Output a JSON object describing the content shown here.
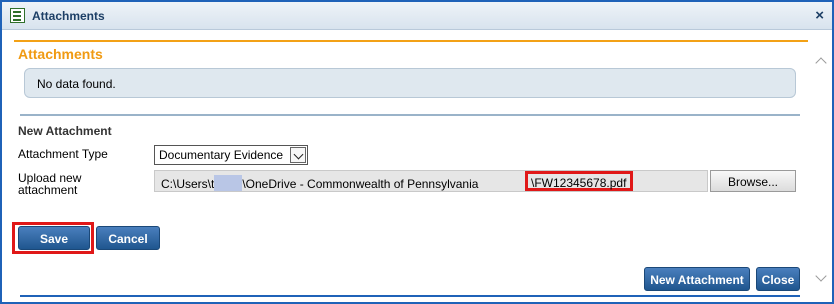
{
  "window": {
    "title": "Attachments",
    "close_glyph": "×"
  },
  "section": {
    "title": "Attachments",
    "empty_message": "No data found."
  },
  "new_attachment": {
    "heading": "New Attachment",
    "type_label": "Attachment Type",
    "type_value": "Documentary Evidence",
    "upload_label": "Upload new attachment",
    "path_prefix": "C:\\Users\\t",
    "path_middle": "\\OneDrive - Commonwealth of Pennsylvania",
    "file_name": "\\FW12345678.pdf",
    "browse_label": "Browse..."
  },
  "actions": {
    "save_label": "Save",
    "cancel_label": "Cancel",
    "new_attachment_label": "New Attachment",
    "close_label": "Close"
  },
  "colors": {
    "accent_orange": "#f09a12",
    "button_blue": "#1f568f",
    "highlight_red": "#e01818",
    "frame_blue": "#1f62b8"
  }
}
